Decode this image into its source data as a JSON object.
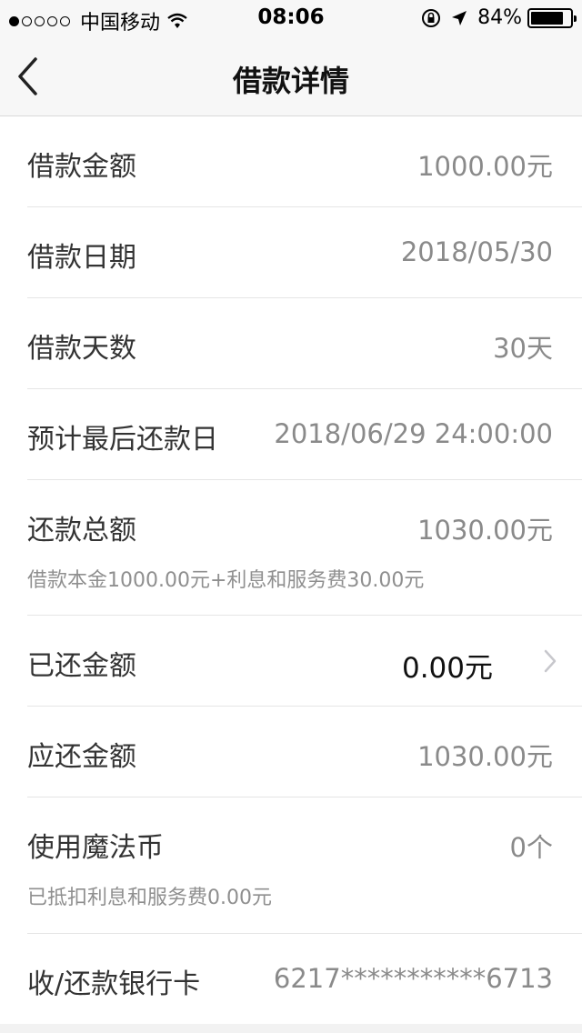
{
  "status_bar": {
    "carrier": "中国移动",
    "time": "08:06",
    "battery_percent": "84%",
    "battery_level": 0.84,
    "signal_dots_filled": 1,
    "signal_dots_total": 5
  },
  "nav": {
    "title": "借款详情",
    "back_icon": "chevron-left-icon"
  },
  "rows": [
    {
      "label": "借款金额",
      "value": "1000.00元"
    },
    {
      "label": "借款日期",
      "value": "2018/05/30"
    },
    {
      "label": "借款天数",
      "value": "30天"
    },
    {
      "label": "预计最后还款日",
      "value": "2018/06/29 24:00:00"
    },
    {
      "label": "还款总额",
      "value": "1030.00元",
      "sub": "借款本金1000.00元+利息和服务费30.00元"
    },
    {
      "label": "已还金额",
      "value": "0.00元"
    },
    {
      "label": "应还金额",
      "value": "1030.00元"
    },
    {
      "label": "使用魔法币",
      "value": "0个",
      "sub": "已抵扣利息和服务费0.00元"
    },
    {
      "label": "收/还款银行卡",
      "value": "6217***********6713"
    }
  ],
  "colors": {
    "bar_bg": "#f7f7f7",
    "label": "#333333",
    "value": "#8a8a8a",
    "divider": "#e5e5e5"
  }
}
